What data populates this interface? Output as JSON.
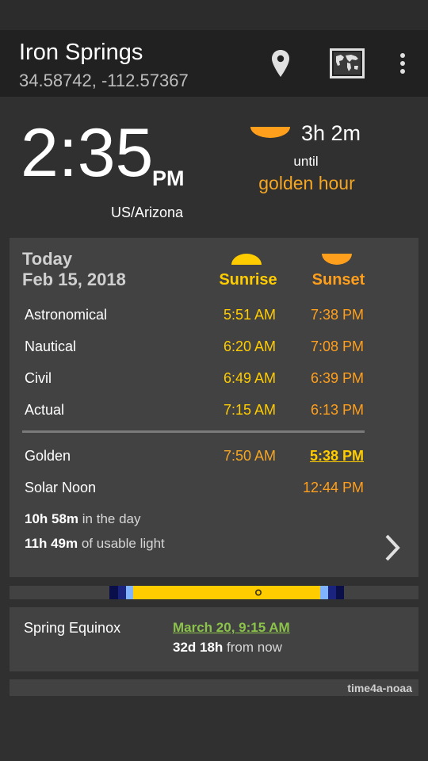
{
  "appbar": {
    "location_name": "Iron Springs",
    "coordinates": "34.58742, -112.57367",
    "icons": [
      "location-pin-icon",
      "world-map-icon",
      "overflow-menu-icon"
    ]
  },
  "clock": {
    "time": "2:35",
    "ampm": "PM",
    "timezone": "US/Arizona"
  },
  "countdown": {
    "duration": "3h 2m",
    "until": "until",
    "event": "golden hour"
  },
  "today": {
    "label": "Today",
    "date": "Feb 15, 2018",
    "sunrise_header": "Sunrise",
    "sunset_header": "Sunset",
    "rows": [
      {
        "label": "Astronomical",
        "sunrise": "5:51 AM",
        "sunset": "7:38 PM"
      },
      {
        "label": "Nautical",
        "sunrise": "6:20 AM",
        "sunset": "7:08 PM"
      },
      {
        "label": "Civil",
        "sunrise": "6:49 AM",
        "sunset": "6:39 PM"
      },
      {
        "label": "Actual",
        "sunrise": "7:15 AM",
        "sunset": "6:13 PM"
      }
    ],
    "golden": {
      "label": "Golden",
      "sunrise": "7:50 AM",
      "sunset": "5:38 PM"
    },
    "noon": {
      "label": "Solar Noon",
      "time": "12:44 PM"
    },
    "day_length": {
      "value": "10h 58m",
      "text": "in the day"
    },
    "usable_light": {
      "value": "11h 49m",
      "text": "of usable light"
    }
  },
  "equinox": {
    "name": "Spring Equinox",
    "date": "March 20, 9:15 AM",
    "relative_value": "32d 18h",
    "relative_text": "from now"
  },
  "footer": {
    "text": "time4a-noaa"
  },
  "colors": {
    "background": "#303030",
    "card": "#424242",
    "sunrise": "#ffcc00",
    "sunset": "#ff9f1c",
    "golden_hour": "#f5a623",
    "link_green": "#8bc34a"
  }
}
